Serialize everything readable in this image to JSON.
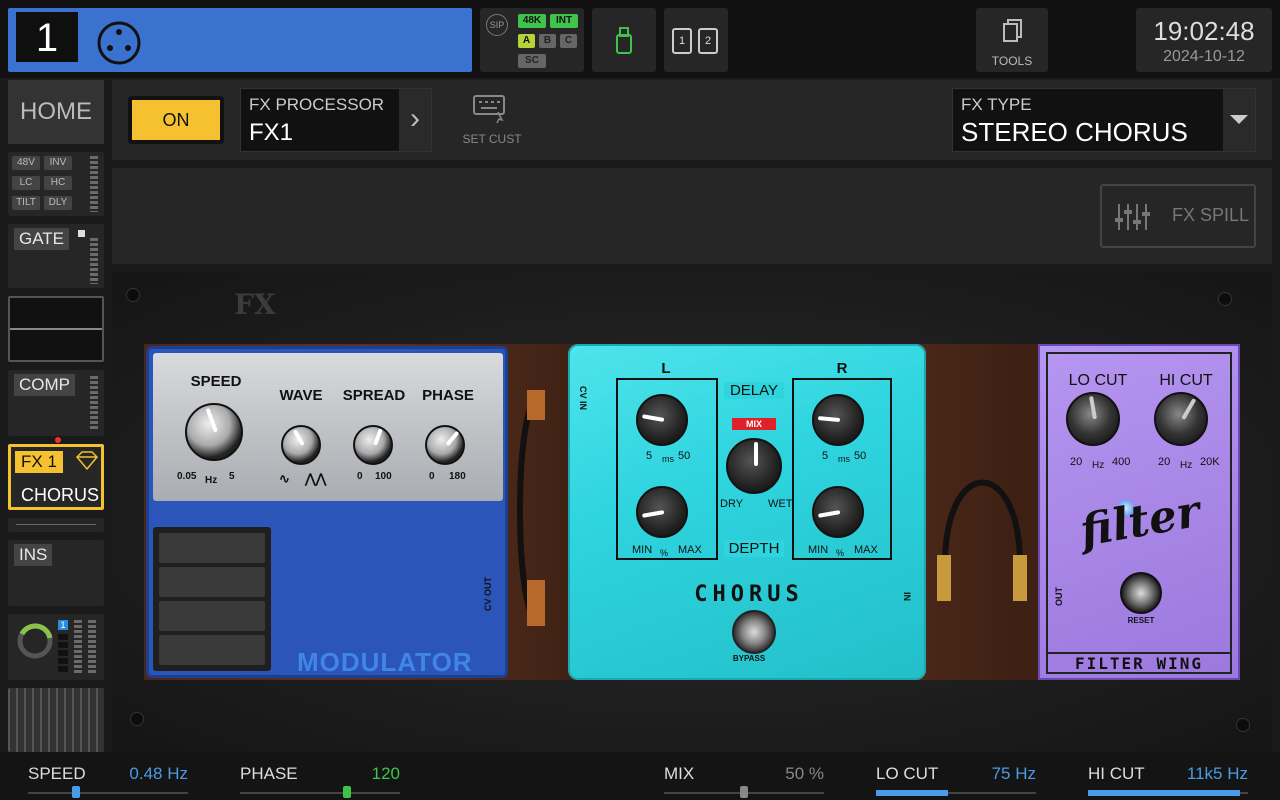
{
  "header": {
    "channel_number": "1",
    "sip_label": "SIP",
    "rate_48k": "48K",
    "int_label": "INT",
    "a_label": "A",
    "b_label": "B",
    "c_label": "C",
    "sc_label": "SC",
    "card1": "1",
    "card2": "2",
    "tools_label": "TOOLS",
    "time": "19:02:48",
    "date": "2024-10-12"
  },
  "sidebar": {
    "home": "HOME",
    "tags": [
      "48V",
      "INV",
      "LC",
      "HC",
      "TILT",
      "DLY"
    ],
    "gate": "GATE",
    "comp": "COMP",
    "fx_slot": "FX 1",
    "fx_name": "CHORUS",
    "ins": "INS",
    "bus_badge": "1"
  },
  "fx_header": {
    "on_label": "ON",
    "processor_caption": "FX PROCESSOR",
    "processor_value": "FX1",
    "set_cust": "SET CUST",
    "type_caption": "FX TYPE",
    "type_value": "STEREO CHORUS",
    "fx_spill": "FX SPILL"
  },
  "rack": {
    "fx_logo": "FX",
    "modulator": {
      "name": "MODULATOR",
      "speed": "SPEED",
      "speed_min": "0.05",
      "speed_unit": "Hz",
      "speed_max": "5",
      "wave": "WAVE",
      "spread": "SPREAD",
      "spread_min": "0",
      "spread_max": "100",
      "phase": "PHASE",
      "phase_min": "0",
      "phase_max": "180",
      "cv_out": "CV OUT"
    },
    "chorus": {
      "name": "CHORUS",
      "cv_in": "CV IN",
      "l": "L",
      "r": "R",
      "delay": "DELAY",
      "depth": "DEPTH",
      "mix": "MIX",
      "dry": "DRY",
      "wet": "WET",
      "d_min": "5",
      "d_unit": "ms",
      "d_max": "50",
      "dep_min": "MIN",
      "dep_unit": "%",
      "dep_max": "MAX",
      "bypass": "BYPASS",
      "in": "IN"
    },
    "filter": {
      "name": "FILTER WING",
      "logo": "filter",
      "lo_cut": "LO CUT",
      "lo_min": "20",
      "lo_unit": "Hz",
      "lo_max": "400",
      "hi_cut": "HI CUT",
      "hi_min": "20",
      "hi_unit": "Hz",
      "hi_max": "20K",
      "out": "OUT",
      "reset": "RESET"
    }
  },
  "params": [
    {
      "name": "SPEED",
      "value": "0.48 Hz",
      "color": "#4a9be8",
      "level": 0.3
    },
    {
      "name": "PHASE",
      "value": "120",
      "color": "#3ec44a",
      "level": 0.67
    },
    {
      "name": "MIX",
      "value": "50 %",
      "color": "#888888",
      "level": 0.5
    },
    {
      "name": "LO CUT",
      "value": "75 Hz",
      "color": "#4a9be8",
      "level": 0.45
    },
    {
      "name": "HI CUT",
      "value": "11k5 Hz",
      "color": "#4a9be8",
      "level": 0.95
    }
  ],
  "colors": {
    "accent_blue": "#3b72cf",
    "on_yellow": "#f5c12e",
    "chorus_cyan": "#2ed4de",
    "filter_purple": "#a585e6",
    "green": "#3ec44a"
  }
}
